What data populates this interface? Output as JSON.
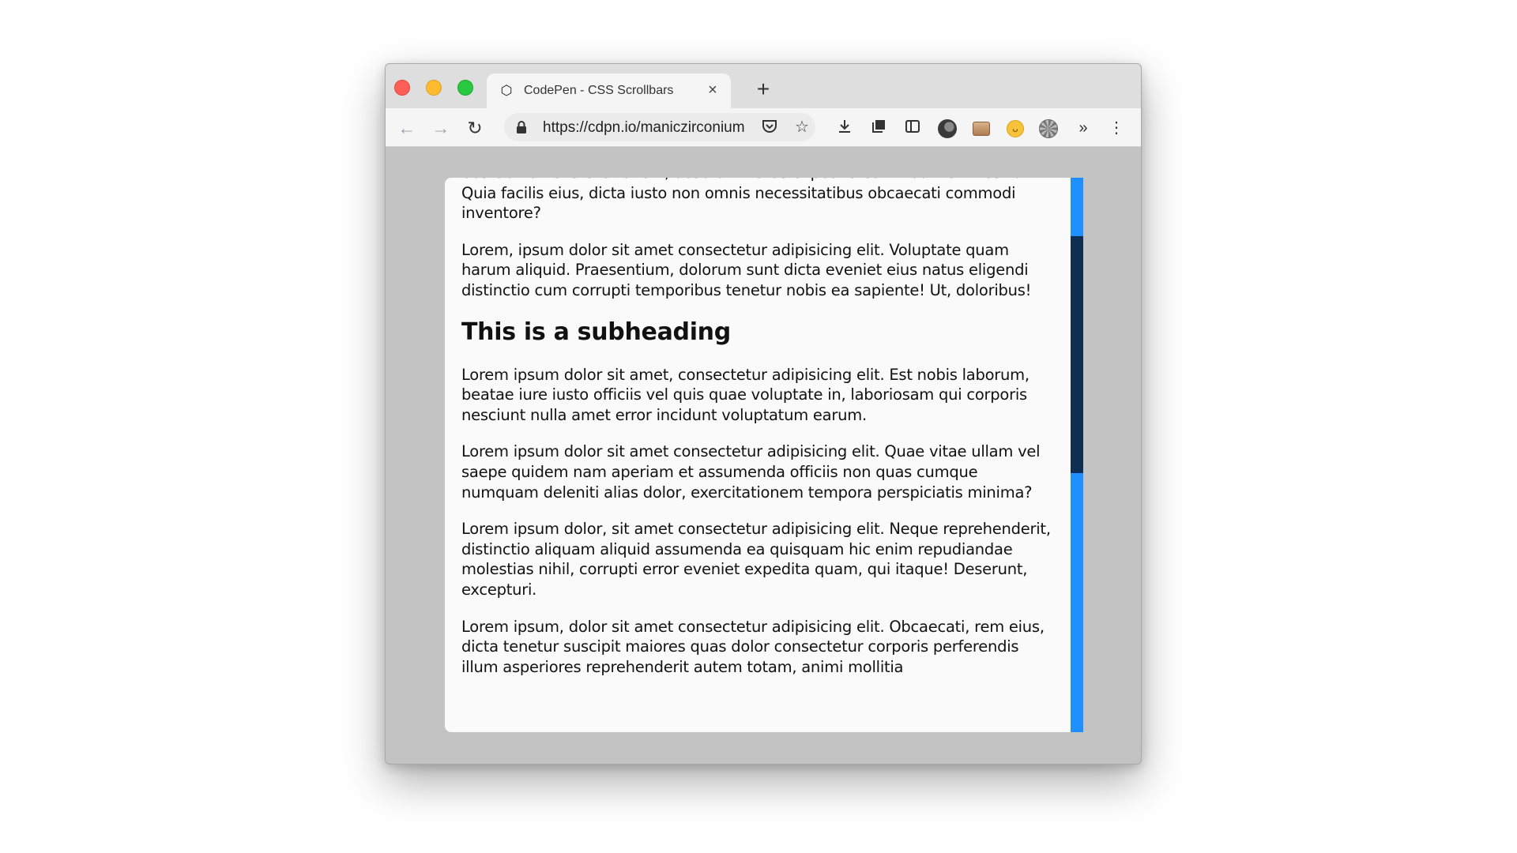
{
  "browser": {
    "tab": {
      "title": "CodePen - CSS Scrollbars",
      "favicon": "codepen-icon",
      "close_glyph": "×"
    },
    "new_tab_glyph": "+",
    "url": "https://cdpn.io/maniczirconium",
    "toolbar_icons": [
      "back-icon",
      "forward-icon",
      "reload-icon",
      "lock-icon",
      "pocket-icon",
      "star-icon",
      "download-icon",
      "library-icon",
      "sidebar-icon",
      "avatar-icon",
      "extension-photo-icon",
      "extension-smile-icon",
      "extension-gear-icon",
      "overflow-icon",
      "menu-icon"
    ]
  },
  "page": {
    "paragraphs_before": [
      "beatae non exercitationem, deserunt natus expedita commodi velit nostrum? Quia facilis eius, dicta iusto non omnis necessitatibus obcaecati commodi inventore?",
      "Lorem, ipsum dolor sit amet consectetur adipisicing elit. Voluptate quam harum aliquid. Praesentium, dolorum sunt dicta eveniet eius natus eligendi distinctio cum corrupti temporibus tenetur nobis ea sapiente! Ut, doloribus!"
    ],
    "subheading": "This is a subheading",
    "paragraphs_after": [
      "Lorem ipsum dolor sit amet, consectetur adipisicing elit. Est nobis laborum, beatae iure iusto officiis vel quis quae voluptate in, laboriosam qui corporis nesciunt nulla amet error incidunt voluptatum earum.",
      "Lorem ipsum dolor sit amet consectetur adipisicing elit. Quae vitae ullam vel saepe quidem nam aperiam et assumenda officiis non quas cumque numquam deleniti alias dolor, exercitationem tempora perspiciatis minima?",
      "Lorem ipsum dolor, sit amet consectetur adipisicing elit. Neque reprehenderit, distinctio aliquam aliquid assumenda ea quisquam hic enim repudiandae molestias nihil, corrupti error eveniet expedita quam, qui itaque! Deserunt, excepturi.",
      "Lorem ipsum, dolor sit amet consectetur adipisicing elit. Obcaecati, rem eius, dicta tenetur suscipit maiores quas dolor consectetur corporis perferendis illum asperiores reprehenderit autem totam, animi mollitia"
    ]
  },
  "scrollbar": {
    "track_color": "#1e90ff",
    "thumb_color": "#0f2f52"
  },
  "colors": {
    "background": "#c3c3c3",
    "card": "#fafafa",
    "text": "#111111"
  }
}
